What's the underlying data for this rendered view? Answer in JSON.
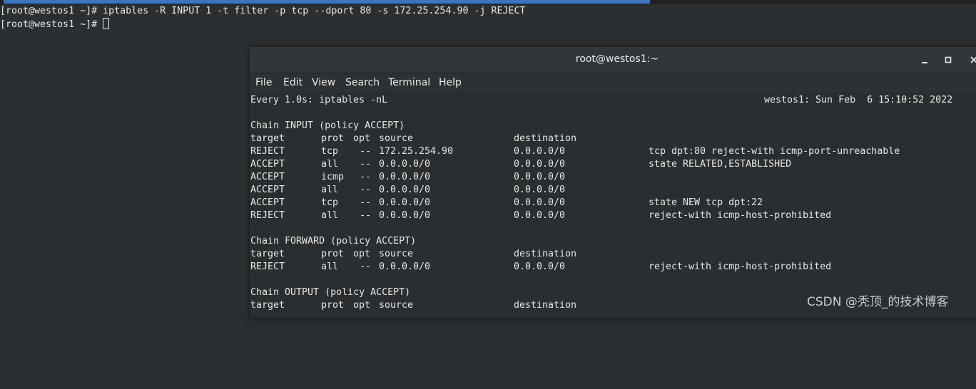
{
  "back_terminal": {
    "line1_prompt": "[root@westos1 ~]# ",
    "line1_command": "iptables -R INPUT 1 -t filter -p tcp --dport 80 -s 172.25.254.90 -j REJECT",
    "line2_prompt": "[root@westos1 ~]# "
  },
  "window": {
    "title": "root@westos1:~",
    "buttons": {
      "minimize": "minimize",
      "maximize": "maximize",
      "close": "close"
    }
  },
  "menu": [
    "File",
    "Edit",
    "View",
    "Search",
    "Terminal",
    "Help"
  ],
  "watch": {
    "header_left": "Every 1.0s: iptables -nL",
    "header_right": "westos1: Sun Feb  6 15:10:52 2022"
  },
  "chains": [
    {
      "title": "Chain INPUT (policy ACCEPT)",
      "columns": [
        "target",
        "prot",
        "opt",
        "source",
        "destination"
      ],
      "rows": [
        [
          "REJECT",
          "tcp",
          "--",
          "172.25.254.90",
          "0.0.0.0/0",
          "tcp dpt:80 reject-with icmp-port-unreachable"
        ],
        [
          "ACCEPT",
          "all",
          "--",
          "0.0.0.0/0",
          "0.0.0.0/0",
          "state RELATED,ESTABLISHED"
        ],
        [
          "ACCEPT",
          "icmp",
          "--",
          "0.0.0.0/0",
          "0.0.0.0/0",
          ""
        ],
        [
          "ACCEPT",
          "all",
          "--",
          "0.0.0.0/0",
          "0.0.0.0/0",
          ""
        ],
        [
          "ACCEPT",
          "tcp",
          "--",
          "0.0.0.0/0",
          "0.0.0.0/0",
          "state NEW tcp dpt:22"
        ],
        [
          "REJECT",
          "all",
          "--",
          "0.0.0.0/0",
          "0.0.0.0/0",
          "reject-with icmp-host-prohibited"
        ]
      ]
    },
    {
      "title": "Chain FORWARD (policy ACCEPT)",
      "columns": [
        "target",
        "prot",
        "opt",
        "source",
        "destination"
      ],
      "rows": [
        [
          "REJECT",
          "all",
          "--",
          "0.0.0.0/0",
          "0.0.0.0/0",
          "reject-with icmp-host-prohibited"
        ]
      ]
    },
    {
      "title": "Chain OUTPUT (policy ACCEPT)",
      "columns": [
        "target",
        "prot",
        "opt",
        "source",
        "destination"
      ],
      "rows": []
    }
  ],
  "watermark": "CSDN @秃顶_的技术博客",
  "colors": {
    "tab_accent": "#3b76c3",
    "terminal_bg": "#2b2e30",
    "text": "#e6e6e6"
  }
}
